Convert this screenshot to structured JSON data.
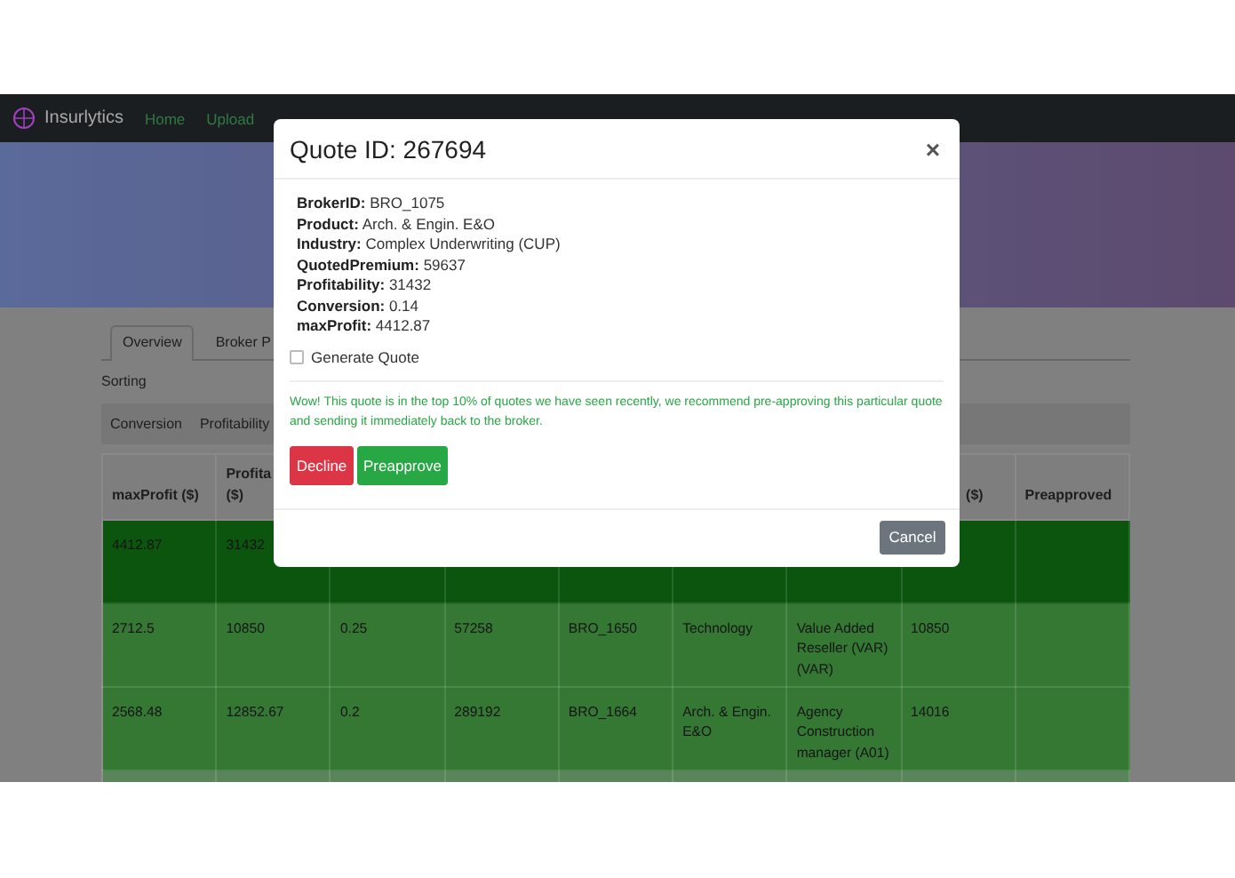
{
  "navbar": {
    "brand": "Insurlytics",
    "links": [
      {
        "label": "Home"
      },
      {
        "label": "Upload"
      }
    ]
  },
  "tabs": [
    {
      "label": "Overview",
      "selected": true
    },
    {
      "label": "Broker P",
      "selected": false
    }
  ],
  "sorting": {
    "label": "Sorting",
    "buttons": [
      "Conversion",
      "Profitability"
    ]
  },
  "table": {
    "columns": [
      {
        "label": "maxProfit ($)"
      },
      {
        "label": "Profita ($)"
      },
      {},
      {},
      {},
      {},
      {},
      {
        "label": "($)"
      },
      {
        "label": "Preapproved"
      }
    ],
    "rows": [
      {
        "color": "#0b550e",
        "cells": [
          "4412.87",
          "31432"
        ]
      },
      {
        "color": "#347834",
        "cells": [
          "2712.5",
          "10850",
          "0.25",
          "57258",
          "BRO_1650",
          "Technology",
          "Value Added Reseller (VAR) (VAR)",
          "10850"
        ]
      },
      {
        "color": "#347834",
        "cells": [
          "2568.48",
          "12852.67",
          "0.2",
          "289192",
          "BRO_1664",
          "Arch. & Engin. E&O",
          "Agency Construction manager (A01)",
          "14016"
        ]
      },
      {
        "color": "#5a845a"
      }
    ]
  },
  "modal": {
    "title": "Quote ID: 267694",
    "close": "×",
    "details": [
      {
        "label": "BrokerID:",
        "value": "BRO_1075"
      },
      {
        "label": "Product:",
        "value": "Arch. & Engin. E&O"
      },
      {
        "label": "Industry:",
        "value": "Complex Underwriting (CUP)"
      },
      {
        "label": "QuotedPremium:",
        "value": "59637"
      },
      {
        "label": "Profitability:",
        "value": "31432"
      },
      {
        "label": "Conversion:",
        "value": "0.14"
      },
      {
        "label": "maxProfit:",
        "value": "4412.87"
      }
    ],
    "checkbox": {
      "label": "Generate Quote",
      "checked": false
    },
    "message": "Wow! This quote is in the top 10% of quotes we have seen recently, we recommend pre-approving this particular quote and sending it immediately back to the broker.",
    "actions": [
      {
        "label": "Decline",
        "kind": "danger"
      },
      {
        "label": "Preapprove",
        "kind": "success"
      }
    ],
    "footer_button": {
      "label": "Cancel",
      "kind": "secondary"
    }
  }
}
